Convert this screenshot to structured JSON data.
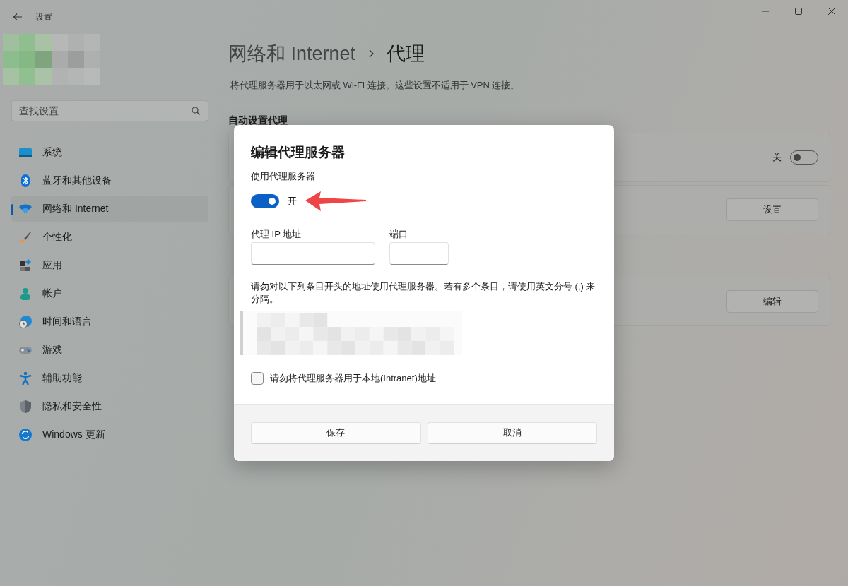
{
  "window": {
    "title": "设置"
  },
  "sidebar": {
    "search": {
      "placeholder": "查找设置"
    },
    "items": [
      {
        "label": "系统",
        "selected": false
      },
      {
        "label": "蓝牙和其他设备",
        "selected": false
      },
      {
        "label": "网络和 Internet",
        "selected": true
      },
      {
        "label": "个性化",
        "selected": false
      },
      {
        "label": "应用",
        "selected": false
      },
      {
        "label": "帐户",
        "selected": false
      },
      {
        "label": "时间和语言",
        "selected": false
      },
      {
        "label": "游戏",
        "selected": false
      },
      {
        "label": "辅助功能",
        "selected": false
      },
      {
        "label": "隐私和安全性",
        "selected": false
      },
      {
        "label": "Windows 更新",
        "selected": false
      }
    ]
  },
  "main": {
    "breadcrumb": {
      "parent": "网络和 Internet",
      "current": "代理"
    },
    "description": "将代理服务器用于以太网或 Wi-Fi 连接。这些设置不适用于 VPN 连接。",
    "section": "自动设置代理",
    "auto_rows": [
      {
        "kind": "toggle",
        "on": false,
        "state_label": "关"
      },
      {
        "kind": "button",
        "button": "设置"
      }
    ],
    "manual_rows": [
      {
        "kind": "button",
        "button": "编辑"
      }
    ]
  },
  "dialog": {
    "title": "编辑代理服务器",
    "use_proxy_label": "使用代理服务器",
    "toggle": {
      "on": true,
      "state_label": "开"
    },
    "fields": [
      {
        "label": "代理 IP 地址"
      },
      {
        "label": "端口"
      }
    ],
    "exceptions_note": "请勿对以下列条目开头的地址使用代理服务器。若有多个条目，请使用英文分号 (;) 来分隔。",
    "checkbox": {
      "label": "请勿将代理服务器用于本地(Intranet)地址",
      "checked": false
    },
    "buttons": [
      "保存",
      "取消"
    ]
  }
}
